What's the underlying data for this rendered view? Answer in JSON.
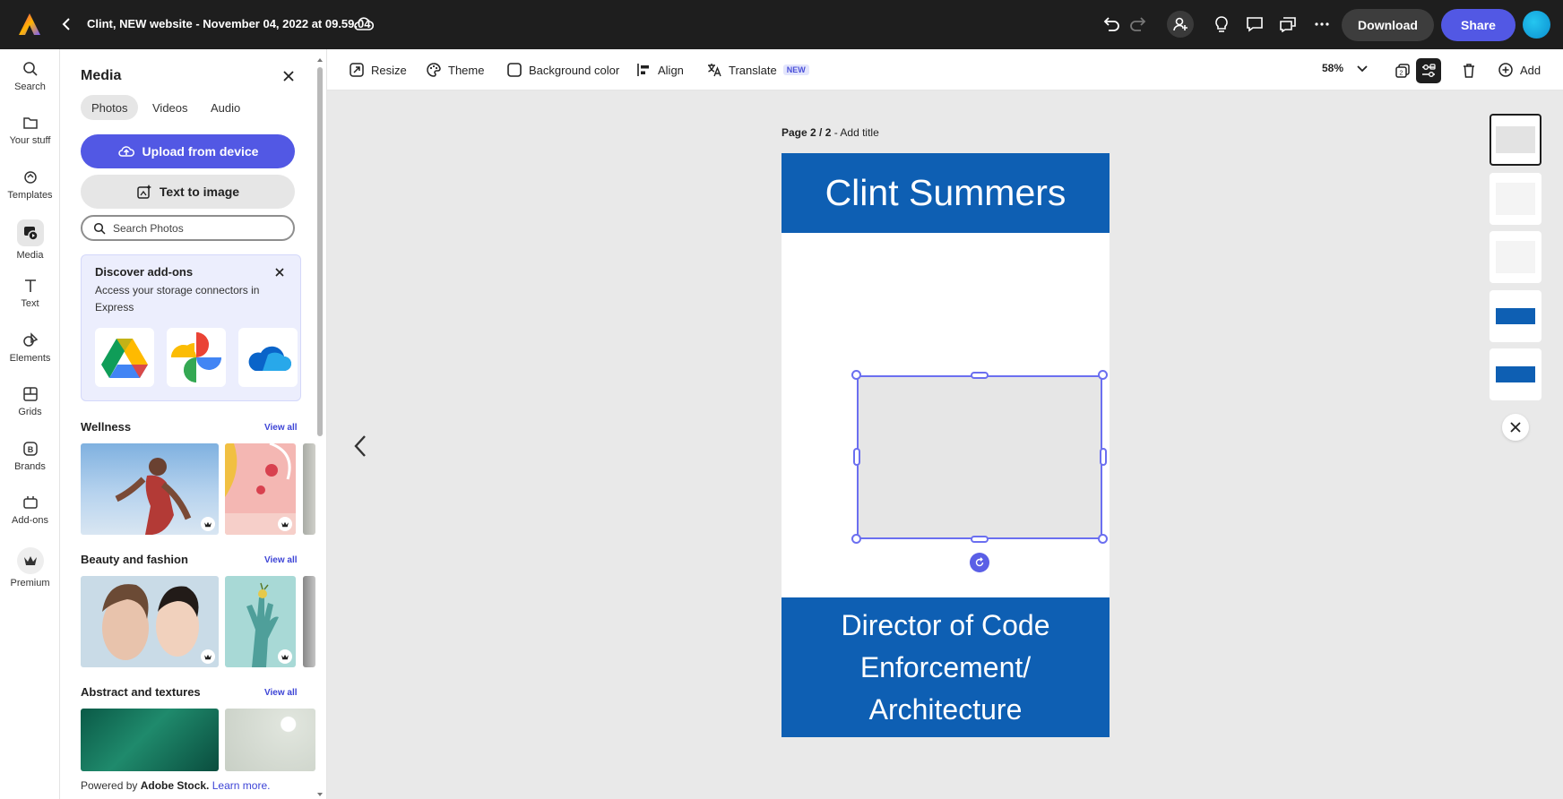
{
  "topbar": {
    "doc_title": "Clint, NEW website - November 04, 2022 at 09.59.04",
    "download_label": "Download",
    "share_label": "Share"
  },
  "rail": {
    "items": [
      {
        "label": "Search",
        "icon": "search-icon"
      },
      {
        "label": "Your stuff",
        "icon": "folder-icon"
      },
      {
        "label": "Templates",
        "icon": "templates-icon"
      },
      {
        "label": "Media",
        "icon": "media-icon"
      },
      {
        "label": "Text",
        "icon": "text-icon"
      },
      {
        "label": "Elements",
        "icon": "elements-icon"
      },
      {
        "label": "Grids",
        "icon": "grid-icon"
      },
      {
        "label": "Brands",
        "icon": "brand-icon"
      },
      {
        "label": "Add-ons",
        "icon": "addons-icon"
      },
      {
        "label": "Premium",
        "icon": "crown-icon"
      }
    ],
    "active": "Media"
  },
  "panel": {
    "title": "Media",
    "tabs": [
      "Photos",
      "Videos",
      "Audio"
    ],
    "active_tab": "Photos",
    "upload_label": "Upload from device",
    "text_to_image_label": "Text to image",
    "search_placeholder": "Search Photos",
    "addons": {
      "title": "Discover add-ons",
      "description": "Access your storage connectors in Express",
      "tiles": [
        "google-drive-icon",
        "google-photos-icon",
        "onedrive-icon"
      ]
    },
    "sections": [
      {
        "title": "Wellness",
        "view_all": "View all"
      },
      {
        "title": "Beauty and fashion",
        "view_all": "View all"
      },
      {
        "title": "Abstract and textures",
        "view_all": "View all"
      }
    ],
    "powered_prefix": "Powered by",
    "powered_brand": "Adobe Stock.",
    "learn_more": "Learn more."
  },
  "toolbar": {
    "resize": "Resize",
    "theme": "Theme",
    "background_color": "Background color",
    "align": "Align",
    "translate": "Translate",
    "new_badge": "NEW",
    "zoom": "58%",
    "add": "Add"
  },
  "canvas": {
    "page_indicator": "Page 2 / 2",
    "page_title_prompt": "- Add title",
    "header_text": "Clint Summers",
    "footer_line1": "Director of Code",
    "footer_line2": "Enforcement/",
    "footer_line3": "Architecture"
  },
  "colors": {
    "accent": "#5258e4",
    "brand_blue": "#0e5fb3",
    "topbar": "#1e1e1e"
  }
}
